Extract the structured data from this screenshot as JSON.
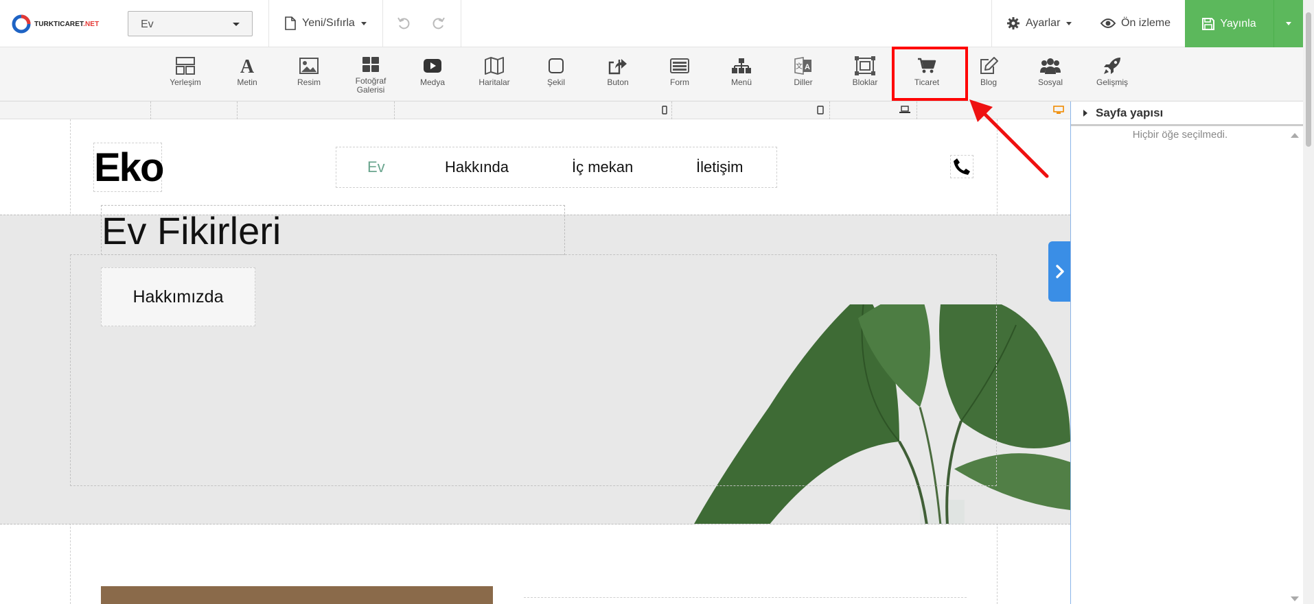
{
  "topbar": {
    "logo_text_main": "TURKTICARET",
    "logo_text_net": ".NET",
    "page_select_value": "Ev",
    "new_reset_label": "Yeni/Sıfırla",
    "settings_label": "Ayarlar",
    "preview_label": "Ön izleme",
    "publish_label": "Yayınla",
    "publish_color": "#5cb85c"
  },
  "ribbon": {
    "items": [
      {
        "label": "Yerleşim",
        "icon": "layout-icon"
      },
      {
        "label": "Metin",
        "icon": "text-icon"
      },
      {
        "label": "Resim",
        "icon": "image-icon"
      },
      {
        "label": "Fotoğraf Galerisi",
        "icon": "gallery-icon"
      },
      {
        "label": "Medya",
        "icon": "video-icon"
      },
      {
        "label": "Haritalar",
        "icon": "map-icon"
      },
      {
        "label": "Şekil",
        "icon": "shape-icon"
      },
      {
        "label": "Buton",
        "icon": "button-share-icon"
      },
      {
        "label": "Form",
        "icon": "form-icon"
      },
      {
        "label": "Menü",
        "icon": "sitemap-icon"
      },
      {
        "label": "Diller",
        "icon": "language-icon"
      },
      {
        "label": "Bloklar",
        "icon": "blocks-icon"
      },
      {
        "label": "Ticaret",
        "icon": "cart-icon"
      },
      {
        "label": "Blog",
        "icon": "blog-edit-icon"
      },
      {
        "label": "Sosyal",
        "icon": "users-icon"
      },
      {
        "label": "Gelişmiş",
        "icon": "rocket-icon"
      }
    ],
    "highlight_color": "#ff0000"
  },
  "site": {
    "brand": "Eko",
    "nav": [
      "Ev",
      "Hakkında",
      "İç mekan",
      "İletişim"
    ],
    "nav_active_color": "#6aa58e",
    "hero_title": "Ev Fikirleri",
    "hero_button": "Hakkımızda"
  },
  "panel": {
    "title": "Sayfa yapısı",
    "empty_text": "Hiçbir öğe seçilmedi."
  }
}
